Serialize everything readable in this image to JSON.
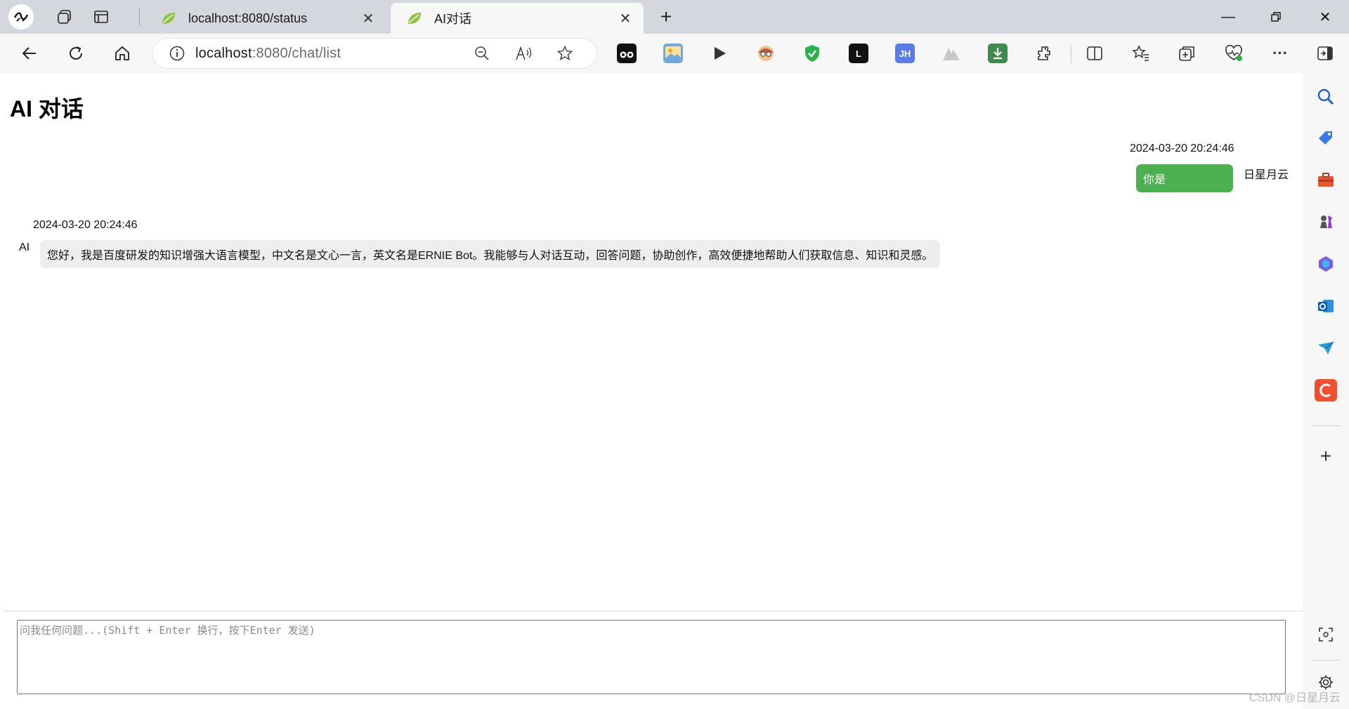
{
  "tabs": [
    {
      "title": "localhost:8080/status",
      "active": false
    },
    {
      "title": "AI对话",
      "active": true
    }
  ],
  "address": {
    "host": "localhost",
    "rest": ":8080/chat/list"
  },
  "page": {
    "title": "AI 对话"
  },
  "messages": {
    "user": {
      "time": "2024-03-20 20:24:46",
      "sender": "日星月云",
      "text": "你是"
    },
    "ai": {
      "time": "2024-03-20 20:24:46",
      "sender": "AI",
      "text": "您好，我是百度研发的知识增强大语言模型，中文名是文心一言，英文名是ERNIE Bot。我能够与人对话互动，回答问题，协助创作，高效便捷地帮助人们获取信息、知识和灵感。"
    }
  },
  "input": {
    "placeholder": "问我任何问题...(Shift + Enter 换行，按下Enter 发送)",
    "value": ""
  },
  "extensions": {
    "jh_label": "JH",
    "l_label": "L"
  },
  "watermark": "CSDN @日星月云",
  "colors": {
    "user_bubble": "#4caf50",
    "ai_bubble": "#eeeeee",
    "titlebar": "#d4d8de",
    "toolbar": "#f7f7f7"
  }
}
